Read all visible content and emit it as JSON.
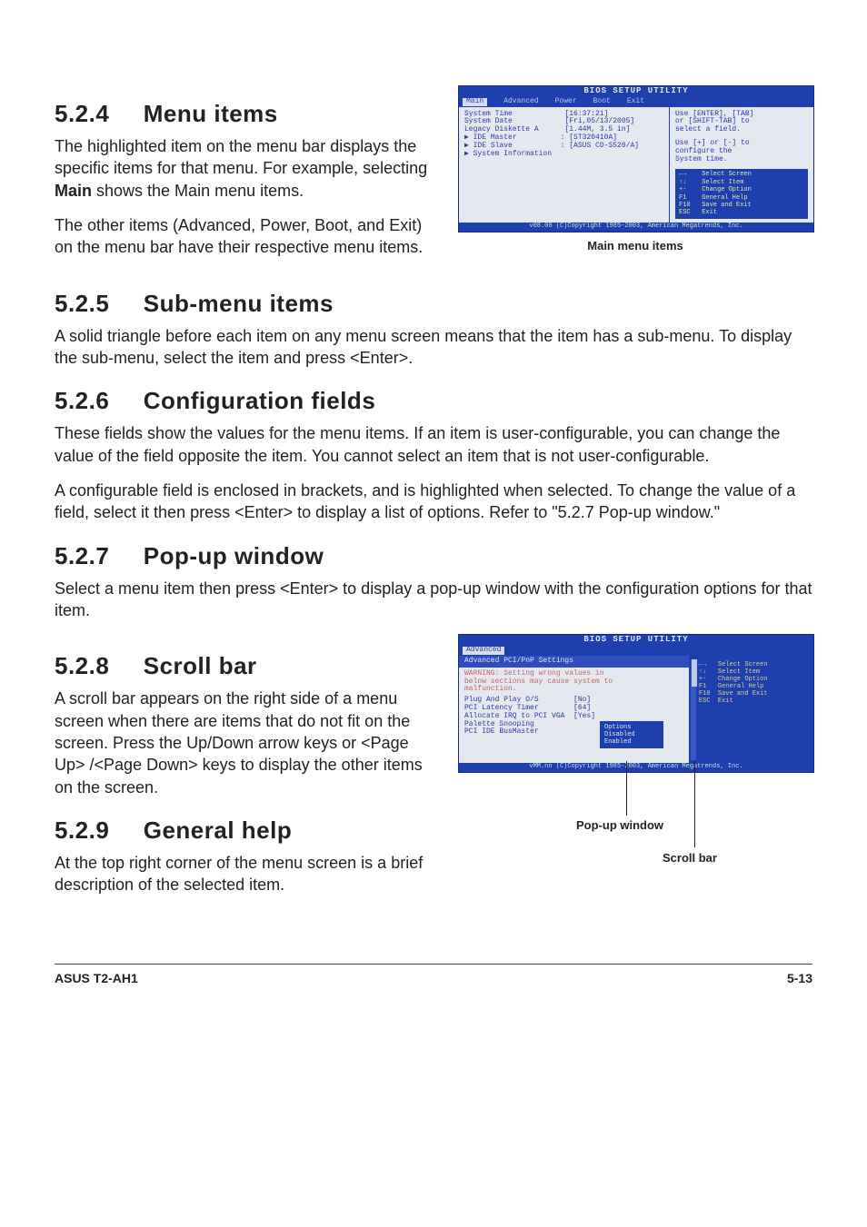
{
  "sections": {
    "s524": {
      "num": "5.2.4",
      "title": "Menu items"
    },
    "s525": {
      "num": "5.2.5",
      "title": "Sub-menu items"
    },
    "s526": {
      "num": "5.2.6",
      "title": "Configuration fields"
    },
    "s527": {
      "num": "5.2.7",
      "title": "Pop-up window"
    },
    "s528": {
      "num": "5.2.8",
      "title": "Scroll bar"
    },
    "s529": {
      "num": "5.2.9",
      "title": "General help"
    }
  },
  "p524a": "The highlighted item on the menu bar  displays the specific items for that menu. For example, selecting ",
  "p524a_bold": "Main",
  "p524a_tail": " shows the Main menu items.",
  "p524b": "The other items (Advanced, Power, Boot, and Exit) on the menu bar have their respective menu items.",
  "p525": "A solid triangle before each item on any menu screen means that the item has a sub-menu. To display the sub-menu, select the item and press <Enter>.",
  "p526a": "These fields show the values for the menu items. If an item is user-configurable, you can change the value of the field opposite the item. You cannot select an item that is not user-configurable.",
  "p526b": "A configurable field is enclosed in brackets, and is highlighted when selected. To change the value of a field, select it then press <Enter> to display a list of options. Refer to \"5.2.7 Pop-up window.\"",
  "p527": "Select a menu item then press <Enter> to display a pop-up window with the configuration options for that item.",
  "p528": "A scroll bar appears on the right side of a menu screen when there are items that do not fit on the screen. Press the Up/Down arrow keys or <Page Up> /<Page Down> keys to display the other items on the screen.",
  "p529": "At the top right corner of the menu screen is a brief description of the selected item.",
  "bios1": {
    "title": "BIOS SETUP UTILITY",
    "tabs": [
      "Main",
      "Advanced",
      "Power",
      "Boot",
      "Exit"
    ],
    "left_rows": [
      "System Time            [16:37:21]",
      "System Date            [Fri,05/13/2005]",
      "Legacy Diskette A      [1.44M, 3.5 in]",
      "",
      "▶ IDE Master          : [ST320410A]",
      "▶ IDE Slave           : [ASUS CD-S520/A]",
      "",
      "▶ System Information"
    ],
    "right_text1": "Use [ENTER], [TAB]\nor [SHIFT-TAB] to\nselect a field.",
    "right_text2": "Use [+] or [-] to\nconfigure the\nSystem time.",
    "help": "←→    Select Screen\n↑↓    Select Item\n+-    Change Option\nF1    General Help\nF10   Save and Exit\nESC   Exit",
    "footer": "v08.00 (C)Copyright 1985-2003, American Megatrends, Inc.",
    "caption": "Main menu items"
  },
  "bios2": {
    "title": "BIOS SETUP UTILITY",
    "tab": "Advanced",
    "heading": "Advanced PCI/PnP Settings",
    "warning": "WARNING: Setting wrong values in\nbelow sections may cause system to\nmalfunction.",
    "rows": [
      "Plug And Play O/S        [No]",
      "PCI Latency Timer        [64]",
      "Allocate IRQ to PCI VGA  [Yes]",
      "Palette Snooping",
      "PCI IDE BusMaster"
    ],
    "popup": "Options\nDisabled\nEnabled",
    "right_help": "←→   Select Screen\n↑↓   Select Item\n+-   Change Option\nF1   General Help\nF10  Save and Exit\nESC  Exit",
    "footer": "vMM.nn (C)Copyright 1985-2003, American Megatrends, Inc."
  },
  "callouts": {
    "popup": "Pop-up window",
    "scroll": "Scroll bar"
  },
  "footer": {
    "left": "ASUS T2-AH1",
    "right": "5-13"
  }
}
